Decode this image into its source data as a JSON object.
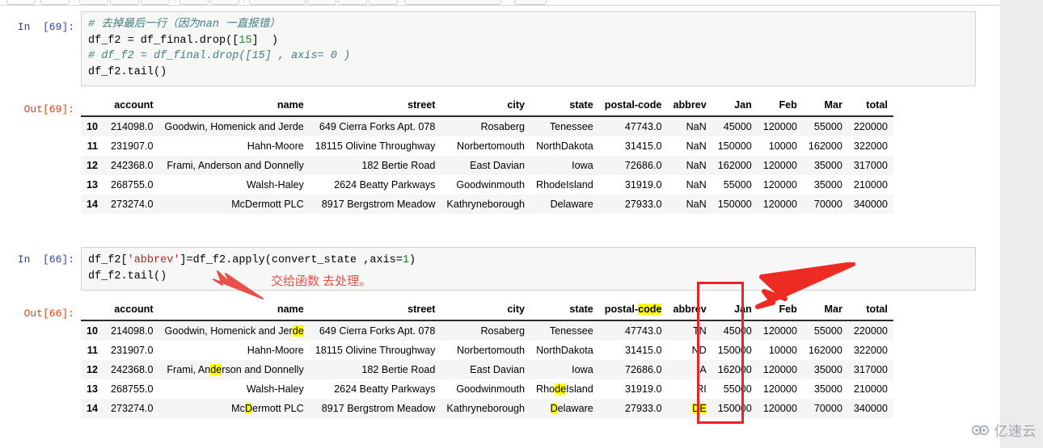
{
  "app": {
    "type": "jupyter-notebook",
    "watermark": "亿速云",
    "watermark_icon": "cloud-icon"
  },
  "colors": {
    "prompt_in": "#303f9f",
    "prompt_out": "#d84315",
    "annotation_red": "#e8504a",
    "box_red": "#ee2222",
    "highlight_yellow": "#ffff00",
    "cell_bg": "#f7f7f7",
    "row_stripe": "#f5f5f5",
    "gutter": "#ececec"
  },
  "cells": [
    {
      "input_prompt": "In  [69]:",
      "output_prompt": "Out[69]:",
      "code_lines": [
        {
          "segments": [
            {
              "t": "# 去掉最后一行（因为nan 一直报错）",
              "k": "cmt"
            }
          ]
        },
        {
          "segments": [
            {
              "t": "df_f2 = df_final.drop([",
              "k": "plain"
            },
            {
              "t": "15",
              "k": "num"
            },
            {
              "t": "]  )",
              "k": "plain"
            }
          ]
        },
        {
          "segments": [
            {
              "t": "# df_f2 = df_final.drop([15] , axis= 0 )",
              "k": "cmt"
            }
          ]
        },
        {
          "segments": [
            {
              "t": "df_f2.tail()",
              "k": "plain"
            }
          ]
        }
      ]
    },
    {
      "input_prompt": "In  [66]:",
      "output_prompt": "Out[66]:",
      "code_lines": [
        {
          "segments": [
            {
              "t": "df_f2[",
              "k": "plain"
            },
            {
              "t": "'abbrev'",
              "k": "str"
            },
            {
              "t": "]=df_f2.apply(convert_state ,axis=",
              "k": "plain"
            },
            {
              "t": "1",
              "k": "num"
            },
            {
              "t": ")",
              "k": "plain"
            }
          ]
        },
        {
          "segments": [
            {
              "t": "df_f2.tail()",
              "k": "plain"
            }
          ]
        }
      ],
      "annotation_text": "交给函数 去处理。"
    }
  ],
  "table_columns": [
    "account",
    "name",
    "street",
    "city",
    "state",
    "postal-code",
    "abbrev",
    "Jan",
    "Feb",
    "Mar",
    "total"
  ],
  "table_before": {
    "columns": [
      "account",
      "name",
      "street",
      "city",
      "state",
      "postal-code",
      "abbrev",
      "Jan",
      "Feb",
      "Mar",
      "total"
    ],
    "rows": [
      {
        "index": "10",
        "cells": [
          "214098.0",
          "Goodwin, Homenick and Jerde",
          "649 Cierra Forks Apt. 078",
          "Rosaberg",
          "Tenessee",
          "47743.0",
          "NaN",
          "45000",
          "120000",
          "55000",
          "220000"
        ]
      },
      {
        "index": "11",
        "cells": [
          "231907.0",
          "Hahn-Moore",
          "18115 Olivine Throughway",
          "Norbertomouth",
          "NorthDakota",
          "31415.0",
          "NaN",
          "150000",
          "10000",
          "162000",
          "322000"
        ]
      },
      {
        "index": "12",
        "cells": [
          "242368.0",
          "Frami, Anderson and Donnelly",
          "182 Bertie Road",
          "East Davian",
          "Iowa",
          "72686.0",
          "NaN",
          "162000",
          "120000",
          "35000",
          "317000"
        ]
      },
      {
        "index": "13",
        "cells": [
          "268755.0",
          "Walsh-Haley",
          "2624 Beatty Parkways",
          "Goodwinmouth",
          "RhodeIsland",
          "31919.0",
          "NaN",
          "55000",
          "120000",
          "35000",
          "210000"
        ]
      },
      {
        "index": "14",
        "cells": [
          "273274.0",
          "McDermott PLC",
          "8917 Bergstrom Meadow",
          "Kathryneborough",
          "Delaware",
          "27933.0",
          "NaN",
          "150000",
          "120000",
          "70000",
          "340000"
        ]
      }
    ]
  },
  "table_after": {
    "columns": [
      "account",
      "name",
      "street",
      "city",
      "state",
      "postal-code",
      "abbrev",
      "Jan",
      "Feb",
      "Mar",
      "total"
    ],
    "header_highlights": {
      "postal-code": "code"
    },
    "rows": [
      {
        "index": "10",
        "cells": [
          "214098.0",
          "Goodwin, Homenick and Jerde",
          "649 Cierra Forks Apt. 078",
          "Rosaberg",
          "Tenessee",
          "47743.0",
          "TN",
          "45000",
          "120000",
          "55000",
          "220000"
        ],
        "highlights": {
          "1": "de"
        }
      },
      {
        "index": "11",
        "cells": [
          "231907.0",
          "Hahn-Moore",
          "18115 Olivine Throughway",
          "Norbertomouth",
          "NorthDakota",
          "31415.0",
          "ND",
          "150000",
          "10000",
          "162000",
          "322000"
        ],
        "highlights": {}
      },
      {
        "index": "12",
        "cells": [
          "242368.0",
          "Frami, Anderson and Donnelly",
          "182 Bertie Road",
          "East Davian",
          "Iowa",
          "72686.0",
          "IA",
          "162000",
          "120000",
          "35000",
          "317000"
        ],
        "highlights": {
          "1": "de"
        }
      },
      {
        "index": "13",
        "cells": [
          "268755.0",
          "Walsh-Haley",
          "2624 Beatty Parkways",
          "Goodwinmouth",
          "RhodeIsland",
          "31919.0",
          "RI",
          "55000",
          "120000",
          "35000",
          "210000"
        ],
        "highlights": {
          "4": "de"
        }
      },
      {
        "index": "14",
        "cells": [
          "273274.0",
          "McDermott PLC",
          "8917 Bergstrom Meadow",
          "Kathryneborough",
          "Delaware",
          "27933.0",
          "DE",
          "150000",
          "120000",
          "70000",
          "340000"
        ],
        "highlights": {
          "1": "D",
          "4": "D",
          "6": "DE"
        }
      }
    ]
  }
}
